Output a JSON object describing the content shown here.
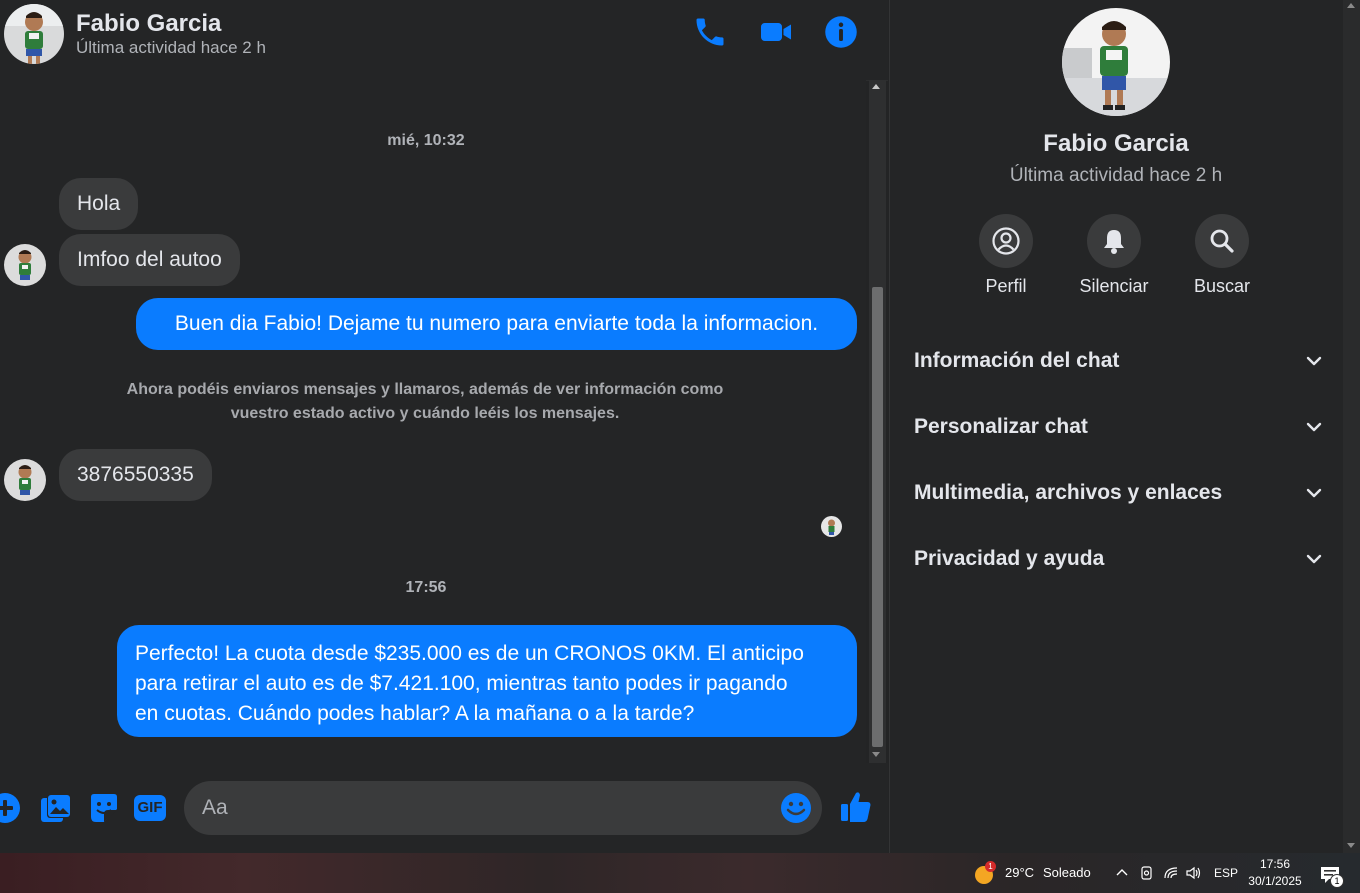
{
  "header": {
    "name": "Fabio Garcia",
    "status": "Última actividad hace 2 h"
  },
  "messages": {
    "timestamp1": "mié, 10:32",
    "in1": "Hola",
    "in2": "Imfoo del autoo",
    "out1": "Buen dia Fabio! Dejame tu numero para enviarte toda la informacion.",
    "system_line1": "Ahora podéis enviaros mensajes y llamaros, además de ver información como",
    "system_line2": "vuestro estado activo y cuándo leéis los mensajes.",
    "in3": "3876550335",
    "timestamp2": "17:56",
    "out2_line1": "Perfecto! La cuota desde $235.000 es de un CRONOS 0KM. El anticipo",
    "out2_line2": "para retirar el auto es de $7.421.100, mientras tanto podes ir pagando",
    "out2_line3": "en cuotas. Cuándo podes hablar? A la mañana o a la tarde?"
  },
  "composer": {
    "placeholder": "Aa",
    "gif_label": "GIF"
  },
  "side": {
    "name": "Fabio Garcia",
    "status": "Última actividad hace 2 h",
    "actions": [
      "Perfil",
      "Silenciar",
      "Buscar"
    ],
    "sections": [
      "Información del chat",
      "Personalizar chat",
      "Multimedia, archivos y enlaces",
      "Privacidad y ayuda"
    ]
  },
  "taskbar": {
    "weather_badge": "1",
    "temperature": "29°C",
    "weather": "Soleado",
    "language": "ESP",
    "time": "17:56",
    "date": "30/1/2025",
    "notif_count": "1"
  },
  "colors": {
    "accent": "#0a7cff",
    "background": "#242526",
    "bubble_in": "#3a3b3c"
  }
}
